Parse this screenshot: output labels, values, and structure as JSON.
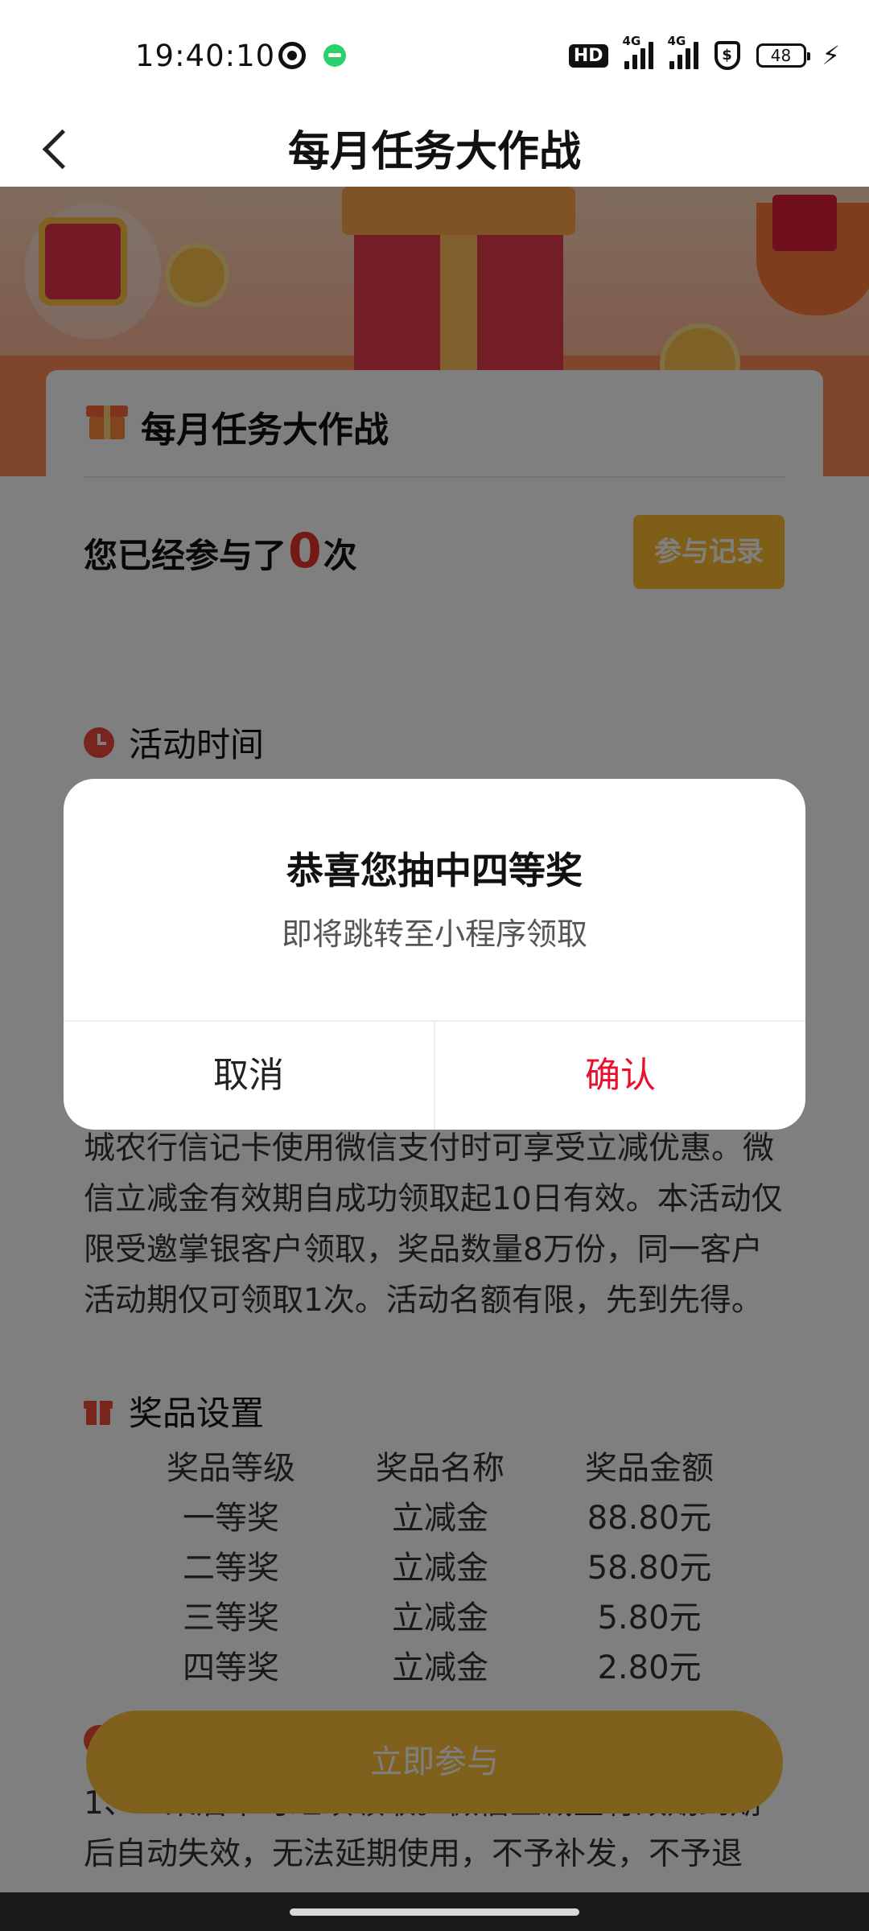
{
  "status_bar": {
    "time": "19:40:10",
    "left_icons": [
      "network-icon",
      "wechat-notification-icon"
    ],
    "hd_label": "HD",
    "signal_1_label": "4G",
    "signal_2_label": "4G",
    "shield_label": "$",
    "battery_level": "48",
    "charging_icon": "bolt-icon"
  },
  "nav": {
    "title": "每月任务大作战",
    "back_icon": "chevron-left-icon"
  },
  "info_card": {
    "title": "每月任务大作战",
    "participation_prefix": "您已经参与了",
    "participation_count": "0",
    "participation_suffix": "次",
    "record_button": "参与记录"
  },
  "rules": {
    "time_heading": "活动时间",
    "rules_text": "城农行信记卡使用微信支付时可享受立减优惠。微信立减金有效期自成功领取起10日有效。本活动仅限受邀掌银客户领取，奖品数量8万份，同一客户活动期仅可领取1次。活动名额有限，先到先得。",
    "prize_heading": "奖品设置",
    "prize_table": {
      "headers": [
        "奖品等级",
        "奖品名称",
        "奖品金额"
      ],
      "rows": [
        [
          "一等奖",
          "立减金",
          "88.80元"
        ],
        [
          "二等奖",
          "立减金",
          "58.80元"
        ],
        [
          "三等奖",
          "立减金",
          "5.80元"
        ],
        [
          "四等奖",
          "立减金",
          "2.80元"
        ]
      ]
    },
    "notes_text": "1、...束后不可继续领取。微信立减金有效期到期后自动失效，无法延期使用，不予补发，不予退"
  },
  "join_button": "立即参与",
  "dialog": {
    "title": "恭喜您抽中四等奖",
    "message": "即将跳转至小程序领取",
    "cancel": "取消",
    "confirm": "确认"
  },
  "colors": {
    "accent_red": "#e8102c",
    "accent_orange": "#ffbf2f",
    "overlay": "rgba(0,0,0,0.5)"
  }
}
